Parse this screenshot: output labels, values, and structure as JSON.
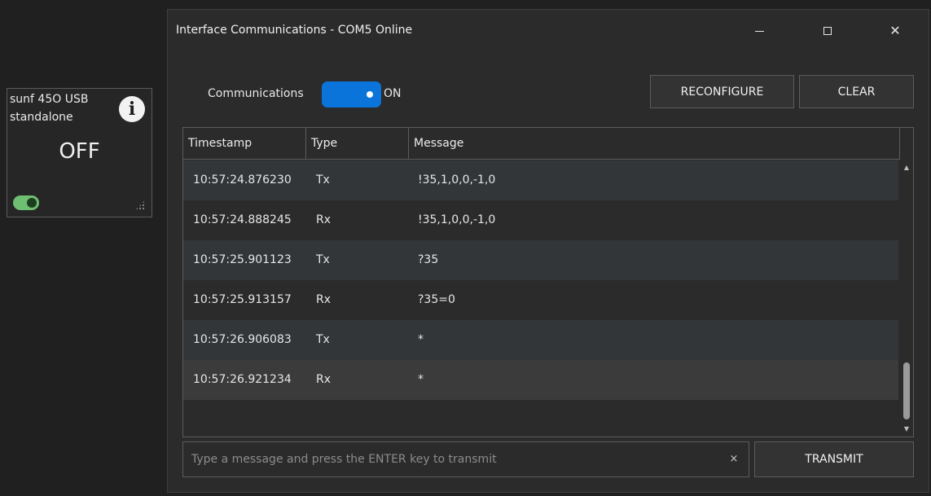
{
  "tile": {
    "name": "sunf 45O USB standalone",
    "state": "OFF",
    "info_glyph": "i",
    "toggle_color": "#6fbf73"
  },
  "window": {
    "title": "Interface Communications - COM5 Online",
    "controls": {
      "close_glyph": "✕"
    }
  },
  "communications": {
    "label": "Communications",
    "state": "ON",
    "switch_color": "#0a74da"
  },
  "buttons": {
    "reconfigure": "RECONFIGURE",
    "clear": "CLEAR",
    "transmit": "TRANSMIT"
  },
  "grid": {
    "columns": [
      "Timestamp",
      "Type",
      "Message"
    ],
    "rows": [
      {
        "timestamp": "10:57:24.876230",
        "type": "Tx",
        "message": "!35,1,0,0,-1,0"
      },
      {
        "timestamp": "10:57:24.888245",
        "type": "Rx",
        "message": "!35,1,0,0,-1,0"
      },
      {
        "timestamp": "10:57:25.901123",
        "type": "Tx",
        "message": "?35"
      },
      {
        "timestamp": "10:57:25.913157",
        "type": "Rx",
        "message": "?35=0"
      },
      {
        "timestamp": "10:57:26.906083",
        "type": "Tx",
        "message": "*"
      },
      {
        "timestamp": "10:57:26.921234",
        "type": "Rx",
        "message": "*"
      }
    ],
    "selected_row": 5,
    "scroll_up_glyph": "▲",
    "scroll_down_glyph": "▼"
  },
  "input": {
    "value": "",
    "placeholder": "Type a message and press the ENTER key to transmit",
    "clear_glyph": "×"
  }
}
